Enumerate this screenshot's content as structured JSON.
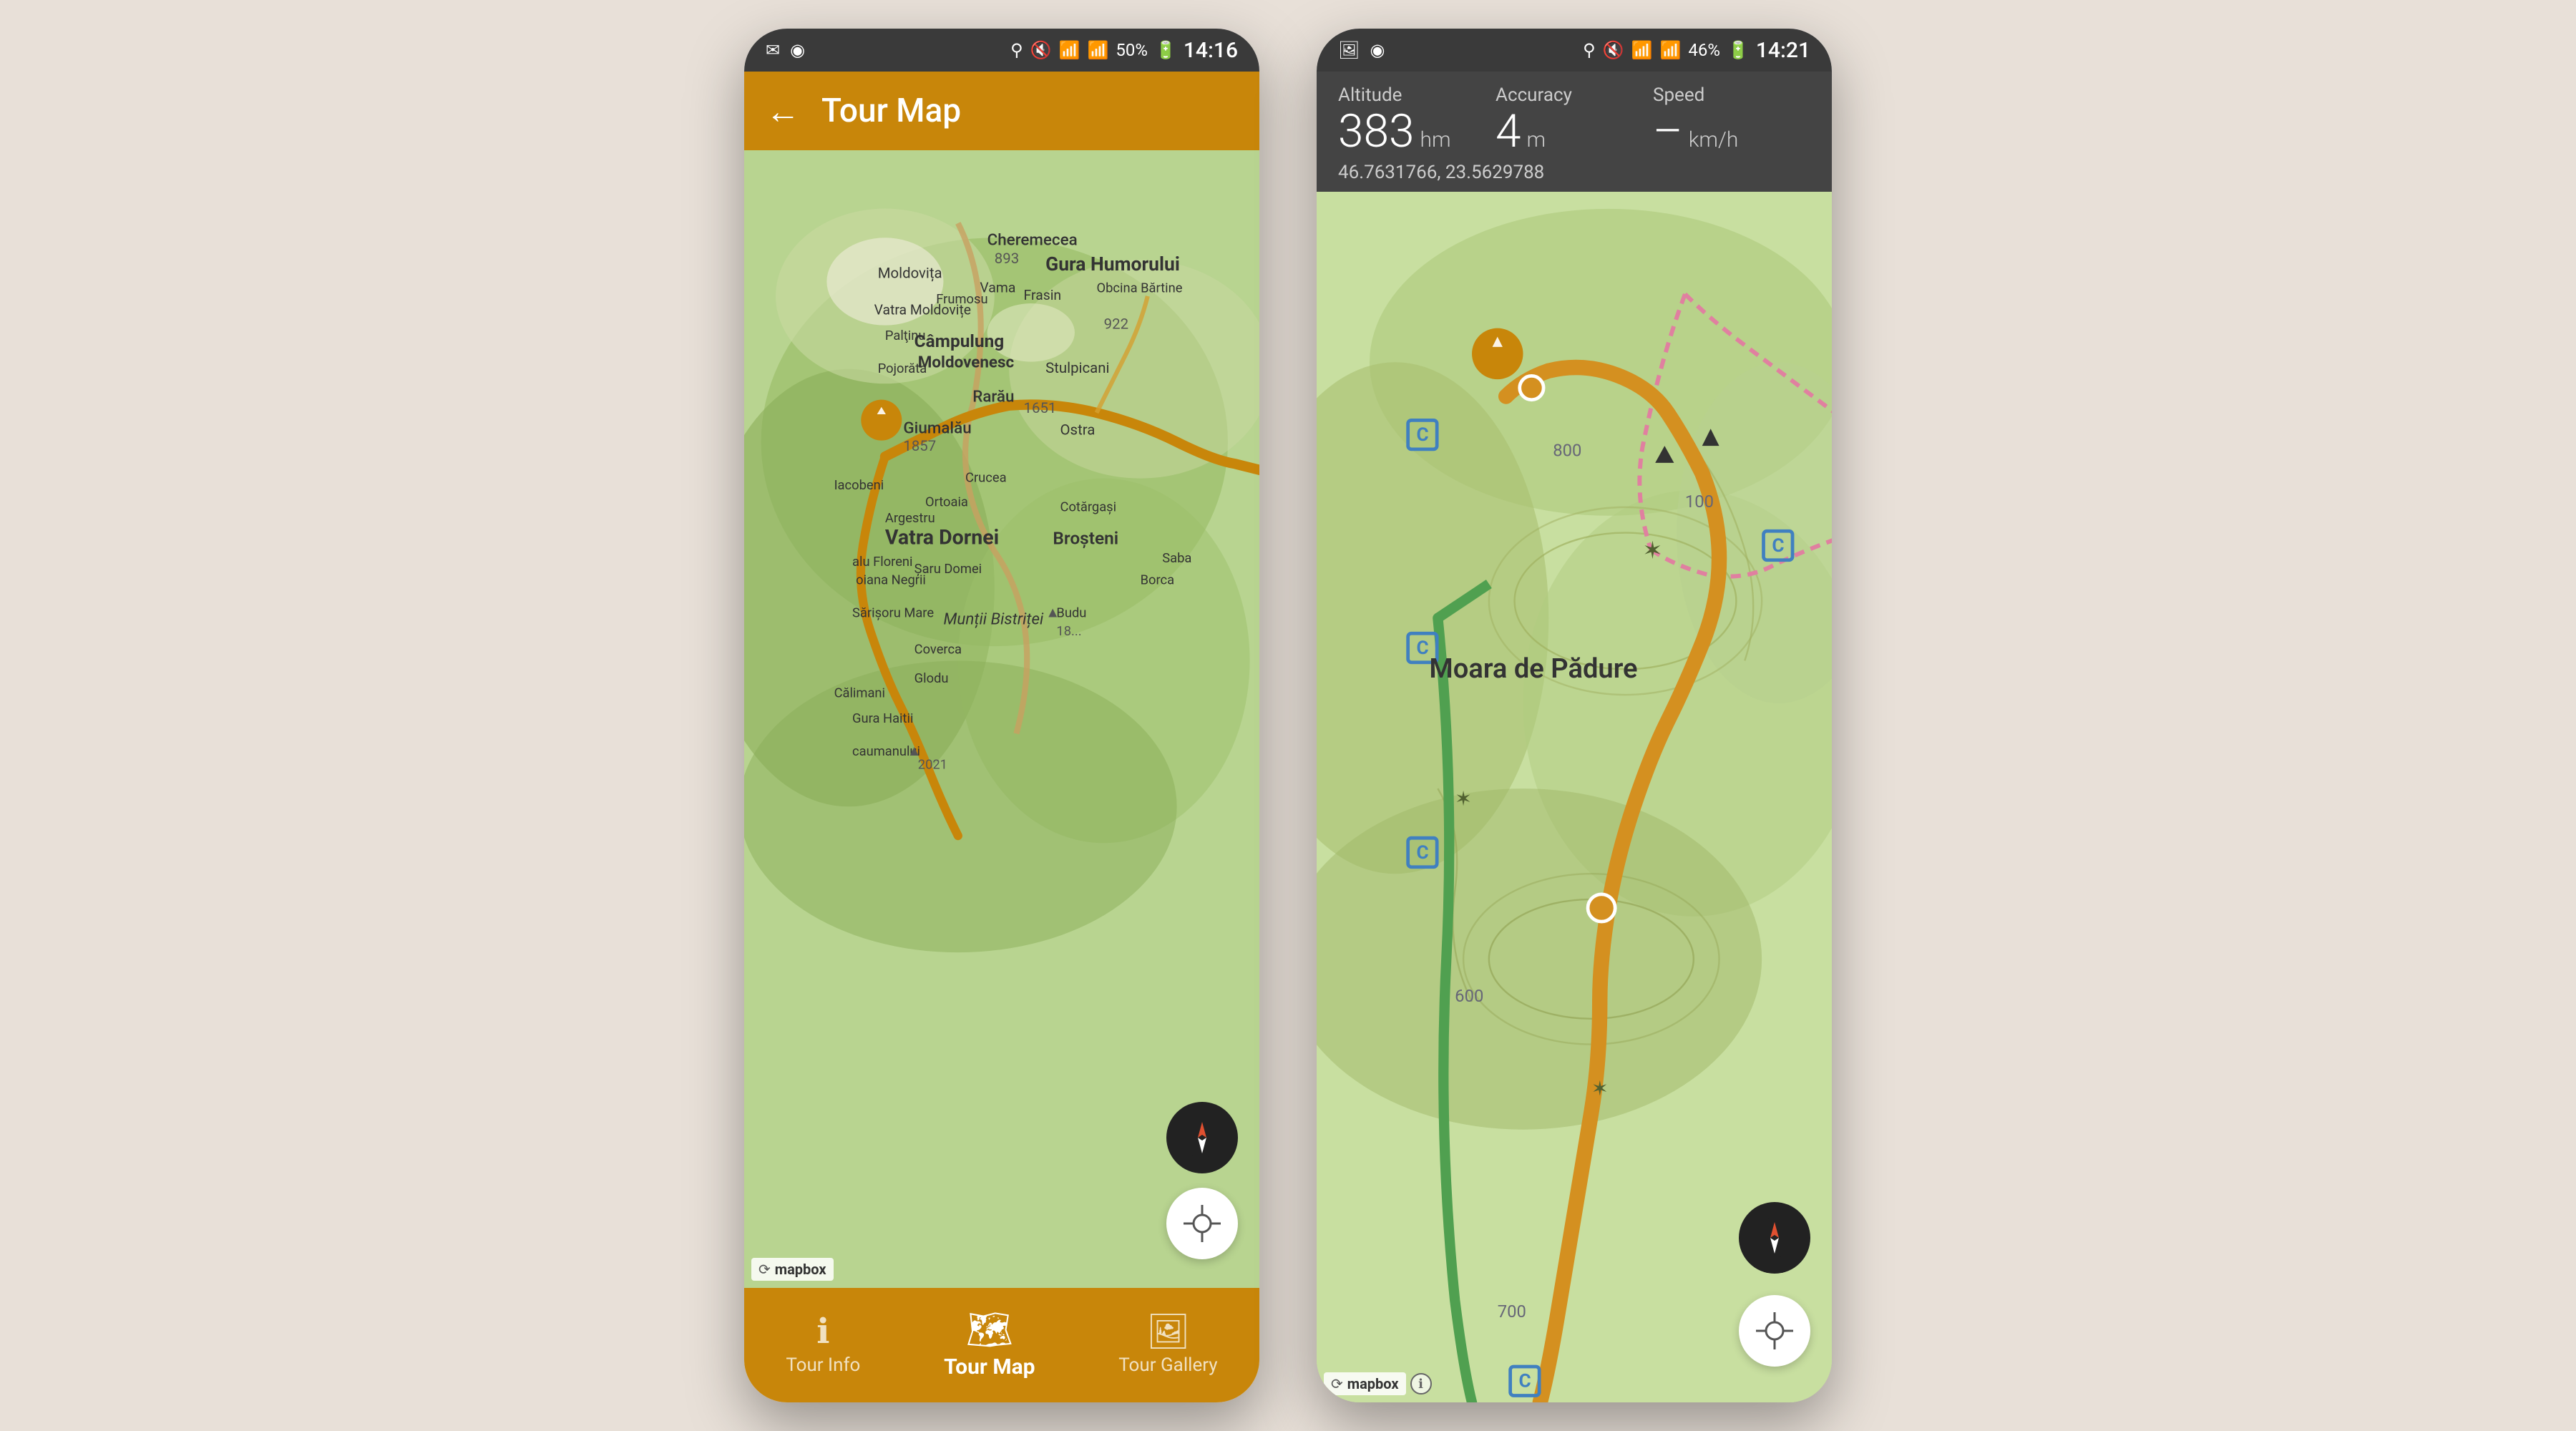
{
  "phone_left": {
    "status_bar": {
      "time": "14:16",
      "battery": "50%"
    },
    "header": {
      "back_label": "←",
      "title": "Tour Map"
    },
    "nav": {
      "items": [
        {
          "id": "tour-info",
          "label": "Tour Info",
          "icon": "ℹ",
          "active": false
        },
        {
          "id": "tour-map",
          "label": "Tour Map",
          "icon": "🗺",
          "active": true
        },
        {
          "id": "tour-gallery",
          "label": "Tour Gallery",
          "icon": "🖼",
          "active": false
        }
      ]
    }
  },
  "phone_right": {
    "status_bar": {
      "time": "14:21",
      "battery": "46%"
    },
    "stats": {
      "altitude_label": "Altitude",
      "altitude_value": "383",
      "altitude_unit": "hm",
      "accuracy_label": "Accuracy",
      "accuracy_value": "4",
      "accuracy_unit": "m",
      "speed_label": "Speed",
      "speed_value": "–",
      "speed_unit": "km/h",
      "coords": "46.7631766, 23.5629788"
    },
    "map_label": "Moara de Pădure"
  }
}
